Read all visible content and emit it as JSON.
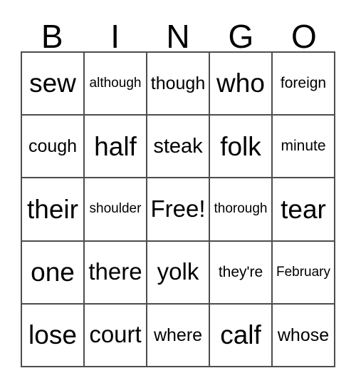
{
  "card": {
    "headers": [
      "B",
      "I",
      "N",
      "G",
      "O"
    ],
    "rows": [
      [
        {
          "text": "sew",
          "size": "fs-xl"
        },
        {
          "text": "although",
          "size": "fs-xxs"
        },
        {
          "text": "though",
          "size": "fs-sm"
        },
        {
          "text": "who",
          "size": "fs-xl"
        },
        {
          "text": "foreign",
          "size": "fs-xs"
        }
      ],
      [
        {
          "text": "cough",
          "size": "fs-sm"
        },
        {
          "text": "half",
          "size": "fs-xl"
        },
        {
          "text": "steak",
          "size": "fs-md"
        },
        {
          "text": "folk",
          "size": "fs-xl"
        },
        {
          "text": "minute",
          "size": "fs-xs"
        }
      ],
      [
        {
          "text": "their",
          "size": "fs-xl"
        },
        {
          "text": "shoulder",
          "size": "fs-xxs"
        },
        {
          "text": "Free!",
          "size": "fs-lg"
        },
        {
          "text": "thorough",
          "size": "fs-xxs"
        },
        {
          "text": "tear",
          "size": "fs-xl"
        }
      ],
      [
        {
          "text": "one",
          "size": "fs-xl"
        },
        {
          "text": "there",
          "size": "fs-lg"
        },
        {
          "text": "yolk",
          "size": "fs-lg"
        },
        {
          "text": "they're",
          "size": "fs-xs"
        },
        {
          "text": "February",
          "size": "fs-xxs"
        }
      ],
      [
        {
          "text": "lose",
          "size": "fs-xl"
        },
        {
          "text": "court",
          "size": "fs-lg"
        },
        {
          "text": "where",
          "size": "fs-sm"
        },
        {
          "text": "calf",
          "size": "fs-xl"
        },
        {
          "text": "whose",
          "size": "fs-sm"
        }
      ]
    ],
    "free_space": {
      "row": 2,
      "column": 2,
      "label": "Free!"
    },
    "colors": {
      "background": "#ffffff",
      "text": "#000000",
      "border": "#4d4d4d"
    }
  }
}
